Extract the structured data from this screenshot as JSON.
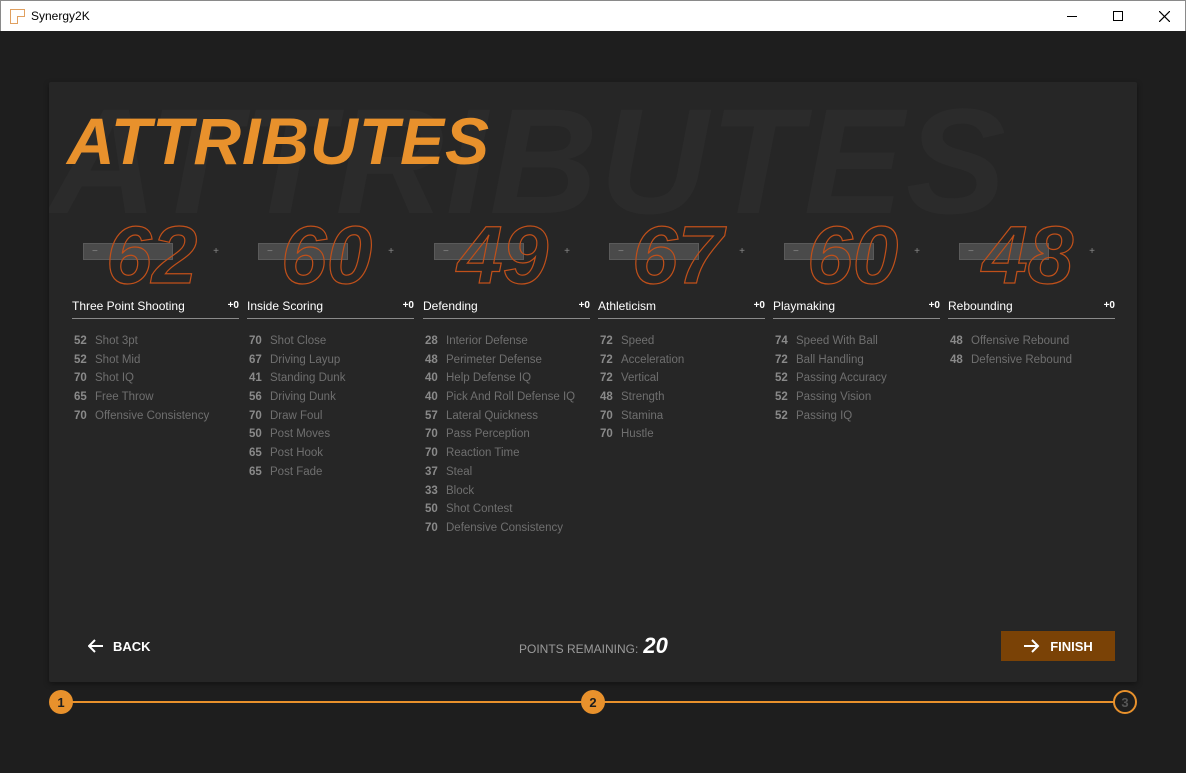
{
  "window": {
    "title": "Synergy2K"
  },
  "page": {
    "title": "ATTRIBUTES",
    "ghost_title": "ATTRIBUTES"
  },
  "categories": [
    {
      "name": "Three Point Shooting",
      "overall": "62",
      "delta": "+0",
      "minus": "−",
      "plus": "+",
      "attributes": [
        {
          "value": "52",
          "name": "Shot 3pt"
        },
        {
          "value": "52",
          "name": "Shot Mid"
        },
        {
          "value": "70",
          "name": "Shot IQ"
        },
        {
          "value": "65",
          "name": "Free Throw"
        },
        {
          "value": "70",
          "name": "Offensive Consistency"
        }
      ]
    },
    {
      "name": "Inside Scoring",
      "overall": "60",
      "delta": "+0",
      "minus": "−",
      "plus": "+",
      "attributes": [
        {
          "value": "70",
          "name": "Shot Close"
        },
        {
          "value": "67",
          "name": "Driving Layup"
        },
        {
          "value": "41",
          "name": "Standing Dunk"
        },
        {
          "value": "56",
          "name": "Driving Dunk"
        },
        {
          "value": "70",
          "name": "Draw Foul"
        },
        {
          "value": "50",
          "name": "Post Moves"
        },
        {
          "value": "65",
          "name": "Post Hook"
        },
        {
          "value": "65",
          "name": "Post Fade"
        }
      ]
    },
    {
      "name": "Defending",
      "overall": "49",
      "delta": "+0",
      "minus": "−",
      "plus": "+",
      "attributes": [
        {
          "value": "28",
          "name": "Interior Defense"
        },
        {
          "value": "48",
          "name": "Perimeter Defense"
        },
        {
          "value": "40",
          "name": "Help Defense IQ"
        },
        {
          "value": "40",
          "name": "Pick And Roll Defense IQ"
        },
        {
          "value": "57",
          "name": "Lateral Quickness"
        },
        {
          "value": "70",
          "name": "Pass Perception"
        },
        {
          "value": "70",
          "name": "Reaction Time"
        },
        {
          "value": "37",
          "name": "Steal"
        },
        {
          "value": "33",
          "name": "Block"
        },
        {
          "value": "50",
          "name": "Shot Contest"
        },
        {
          "value": "70",
          "name": "Defensive Consistency"
        }
      ]
    },
    {
      "name": "Athleticism",
      "overall": "67",
      "delta": "+0",
      "minus": "−",
      "plus": "+",
      "attributes": [
        {
          "value": "72",
          "name": "Speed"
        },
        {
          "value": "72",
          "name": "Acceleration"
        },
        {
          "value": "72",
          "name": "Vertical"
        },
        {
          "value": "48",
          "name": "Strength"
        },
        {
          "value": "70",
          "name": "Stamina"
        },
        {
          "value": "70",
          "name": "Hustle"
        }
      ]
    },
    {
      "name": "Playmaking",
      "overall": "60",
      "delta": "+0",
      "minus": "−",
      "plus": "+",
      "attributes": [
        {
          "value": "74",
          "name": "Speed With Ball"
        },
        {
          "value": "72",
          "name": "Ball Handling"
        },
        {
          "value": "52",
          "name": "Passing Accuracy"
        },
        {
          "value": "52",
          "name": "Passing Vision"
        },
        {
          "value": "52",
          "name": "Passing IQ"
        }
      ]
    },
    {
      "name": "Rebounding",
      "overall": "48",
      "delta": "+0",
      "minus": "−",
      "plus": "+",
      "attributes": [
        {
          "value": "48",
          "name": "Offensive Rebound"
        },
        {
          "value": "48",
          "name": "Defensive Rebound"
        }
      ]
    }
  ],
  "footer": {
    "back_label": "BACK",
    "points_label": "POINTS REMAINING:",
    "points_value": "20",
    "finish_label": "FINISH"
  },
  "stepper": {
    "steps": [
      "1",
      "2",
      "3"
    ],
    "current_step": 2
  },
  "colors": {
    "accent": "#e8912c",
    "finish_bg": "#7a4206",
    "number_outline": "#c0501a",
    "background": "#1e1e1e",
    "card": "#262626"
  }
}
